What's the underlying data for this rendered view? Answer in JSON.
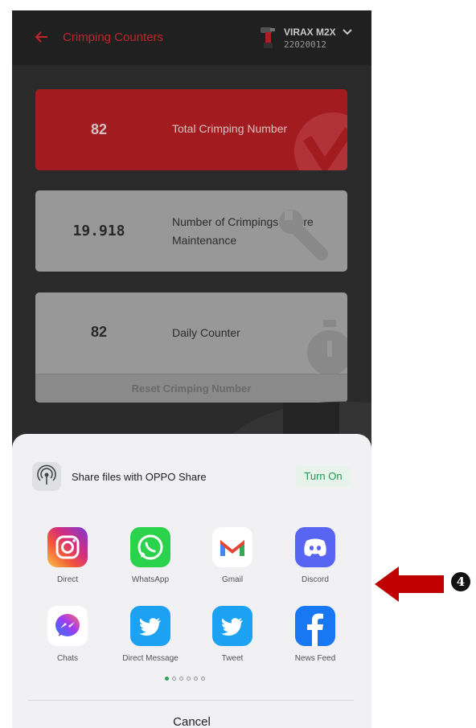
{
  "appbar": {
    "title": "Crimping Counters",
    "device_name": "VIRAX M2X",
    "device_serial": "22020012",
    "accent_color": "#c8262b"
  },
  "cards": [
    {
      "value": "82",
      "label": "Total Crimping Number",
      "icon": "virax-logo-icon"
    },
    {
      "value": "19.918",
      "label": "Number of Crimpings before Maintenance",
      "icon": "wrench-icon"
    },
    {
      "value": "82",
      "label": "Daily Counter",
      "icon": "stopwatch-icon",
      "footer": "Reset Crimping Number"
    }
  ],
  "share_sheet": {
    "oppo_share_text": "Share files with OPPO Share",
    "turn_on_label": "Turn On",
    "apps": [
      {
        "label": "Direct",
        "icon": "instagram-icon"
      },
      {
        "label": "WhatsApp",
        "icon": "whatsapp-icon"
      },
      {
        "label": "Gmail",
        "icon": "gmail-icon"
      },
      {
        "label": "Discord",
        "icon": "discord-icon"
      },
      {
        "label": "Chats",
        "icon": "messenger-icon"
      },
      {
        "label": "Direct Message",
        "icon": "twitter-icon"
      },
      {
        "label": "Tweet",
        "icon": "twitter-icon"
      },
      {
        "label": "News Feed",
        "icon": "facebook-icon"
      }
    ],
    "page_count": 6,
    "active_page": 1,
    "cancel_label": "Cancel"
  },
  "annotation": {
    "step_number": "4",
    "arrow_color": "#c00000"
  }
}
